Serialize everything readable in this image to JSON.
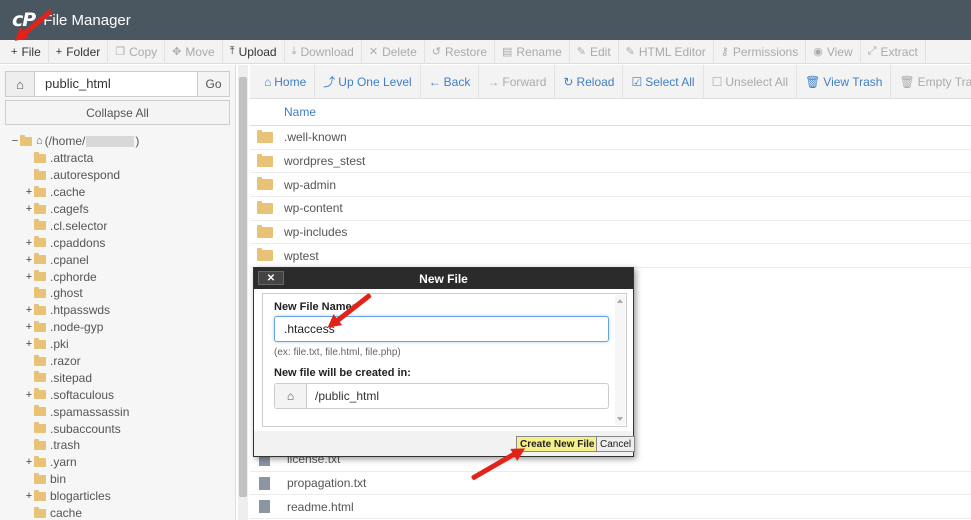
{
  "header": {
    "logo": "cP",
    "title": "File Manager"
  },
  "toolbar": [
    {
      "icon": "+",
      "label": "File",
      "enabled": true,
      "name": "toolbar-file-button"
    },
    {
      "icon": "+",
      "label": "Folder",
      "enabled": true,
      "name": "toolbar-folder-button"
    },
    {
      "icon": "❐",
      "label": "Copy",
      "enabled": false,
      "name": "toolbar-copy-button"
    },
    {
      "icon": "✥",
      "label": "Move",
      "enabled": false,
      "name": "toolbar-move-button"
    },
    {
      "icon": "⤒",
      "label": "Upload",
      "enabled": true,
      "name": "toolbar-upload-button"
    },
    {
      "icon": "⤓",
      "label": "Download",
      "enabled": false,
      "name": "toolbar-download-button"
    },
    {
      "icon": "✕",
      "label": "Delete",
      "enabled": false,
      "name": "toolbar-delete-button"
    },
    {
      "icon": "↺",
      "label": "Restore",
      "enabled": false,
      "name": "toolbar-restore-button"
    },
    {
      "icon": "▤",
      "label": "Rename",
      "enabled": false,
      "name": "toolbar-rename-button"
    },
    {
      "icon": "✎",
      "label": "Edit",
      "enabled": false,
      "name": "toolbar-edit-button"
    },
    {
      "icon": "✎",
      "label": "HTML Editor",
      "enabled": false,
      "name": "toolbar-html-editor-button"
    },
    {
      "icon": "⚷",
      "label": "Permissions",
      "enabled": false,
      "name": "toolbar-permissions-button"
    },
    {
      "icon": "◉",
      "label": "View",
      "enabled": false,
      "name": "toolbar-view-button"
    },
    {
      "icon": "⤢",
      "label": "Extract",
      "enabled": false,
      "name": "toolbar-extract-button"
    }
  ],
  "left": {
    "path_value": "public_html",
    "go_label": "Go",
    "collapse_label": "Collapse All",
    "root_label": "(/home/",
    "root_suffix": ")",
    "tree": [
      {
        "toggle": "",
        "label": ".attracta"
      },
      {
        "toggle": "",
        "label": ".autorespond"
      },
      {
        "toggle": "+",
        "label": ".cache"
      },
      {
        "toggle": "+",
        "label": ".cagefs"
      },
      {
        "toggle": "",
        "label": ".cl.selector"
      },
      {
        "toggle": "+",
        "label": ".cpaddons"
      },
      {
        "toggle": "+",
        "label": ".cpanel"
      },
      {
        "toggle": "+",
        "label": ".cphorde"
      },
      {
        "toggle": "",
        "label": ".ghost"
      },
      {
        "toggle": "+",
        "label": ".htpasswds"
      },
      {
        "toggle": "+",
        "label": ".node-gyp"
      },
      {
        "toggle": "+",
        "label": ".pki"
      },
      {
        "toggle": "",
        "label": ".razor"
      },
      {
        "toggle": "",
        "label": ".sitepad"
      },
      {
        "toggle": "+",
        "label": ".softaculous"
      },
      {
        "toggle": "",
        "label": ".spamassassin"
      },
      {
        "toggle": "",
        "label": ".subaccounts"
      },
      {
        "toggle": "",
        "label": ".trash"
      },
      {
        "toggle": "+",
        "label": ".yarn"
      },
      {
        "toggle": "",
        "label": "bin"
      },
      {
        "toggle": "+",
        "label": "blogarticles"
      },
      {
        "toggle": "",
        "label": "cache"
      }
    ]
  },
  "nav": [
    {
      "icon": "⌂",
      "label": "Home",
      "enabled": true,
      "name": "nav-home-button"
    },
    {
      "icon": "⤴",
      "label": "Up One Level",
      "enabled": true,
      "name": "nav-up-one-level-button"
    },
    {
      "icon": "←",
      "label": "Back",
      "enabled": true,
      "name": "nav-back-button"
    },
    {
      "icon": "→",
      "label": "Forward",
      "enabled": false,
      "name": "nav-forward-button"
    },
    {
      "icon": "↻",
      "label": "Reload",
      "enabled": true,
      "name": "nav-reload-button"
    },
    {
      "icon": "☑",
      "label": "Select All",
      "enabled": true,
      "name": "nav-select-all-button"
    },
    {
      "icon": "☐",
      "label": "Unselect All",
      "enabled": false,
      "name": "nav-unselect-all-button"
    },
    {
      "icon": "🗑",
      "label": "View Trash",
      "enabled": true,
      "name": "nav-view-trash-button"
    },
    {
      "icon": "🗑",
      "label": "Empty Trash",
      "enabled": false,
      "name": "nav-empty-trash-button"
    }
  ],
  "files": {
    "column_name": "Name",
    "rows": [
      {
        "type": "folder",
        "name": ".well-known"
      },
      {
        "type": "folder",
        "name": "wordpres_stest"
      },
      {
        "type": "folder",
        "name": "wp-admin"
      },
      {
        "type": "folder",
        "name": "wp-content"
      },
      {
        "type": "folder",
        "name": "wp-includes"
      },
      {
        "type": "folder",
        "name": "wptest"
      }
    ],
    "bottom_rows": [
      {
        "type": "file",
        "name": "license.txt"
      },
      {
        "type": "file",
        "name": "propagation.txt"
      },
      {
        "type": "file",
        "name": "readme.html"
      }
    ]
  },
  "modal": {
    "title": "New File",
    "close_label": "✕",
    "name_label": "New File Name:",
    "name_value": ".htaccess",
    "hint": "(ex: file.txt, file.html, file.php)",
    "location_label": "New file will be created in:",
    "location_value": "/public_html",
    "create_label": "Create New File",
    "cancel_label": "Cancel"
  },
  "colors": {
    "header": "#4a5761",
    "link": "#3f80c7",
    "folder": "#e8c277",
    "annotation": "#e2231a",
    "create_button": "#f5f08a"
  }
}
